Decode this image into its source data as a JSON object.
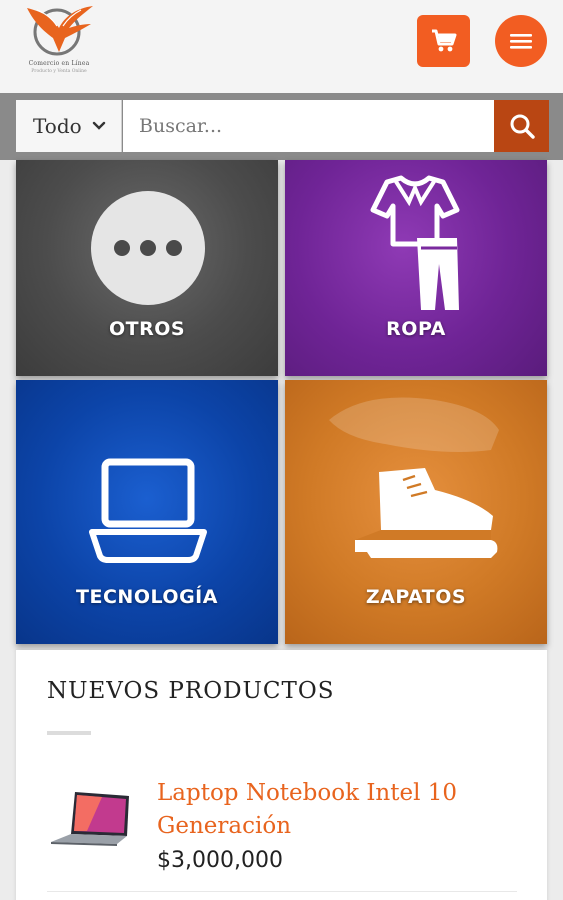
{
  "header": {
    "logo_line1": "Comercio en Línea",
    "logo_line2": "Producto y Venta Online",
    "accent_color": "#f25d22"
  },
  "search": {
    "category_selected": "Todo",
    "placeholder": "Buscar..."
  },
  "categories": [
    {
      "label": "OTROS",
      "icon": "more-dots-icon",
      "color": "#555555"
    },
    {
      "label": "ROPA",
      "icon": "clothes-icon",
      "color": "#7a2a9e"
    },
    {
      "label": "TECNOLOGÍA",
      "icon": "laptop-icon",
      "color": "#0d47a1"
    },
    {
      "label": "ZAPATOS",
      "icon": "shoe-icon",
      "color": "#d07a26"
    }
  ],
  "new_products": {
    "title": "NUEVOS PRODUCTOS",
    "items": [
      {
        "name": "Laptop Notebook Intel 10 Generación",
        "price": "$3,000,000"
      }
    ]
  }
}
